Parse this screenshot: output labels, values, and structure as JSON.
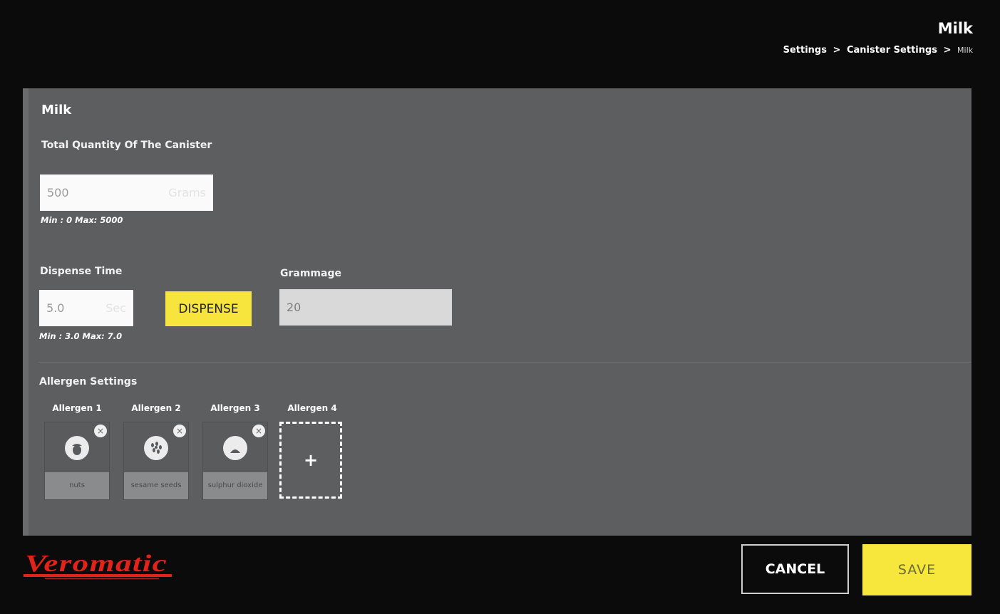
{
  "header": {
    "title": "Milk",
    "breadcrumb": [
      "Settings",
      "Canister Settings",
      "Milk"
    ],
    "breadcrumb_separator": ">"
  },
  "panel": {
    "section_title": "Milk",
    "total_quantity": {
      "label": "Total Quantity Of The Canister",
      "value": "500",
      "unit": "Grams",
      "hint": "Min : 0 Max: 5000"
    },
    "dispense_time": {
      "label": "Dispense Time",
      "value": "5.0",
      "unit": "Sec",
      "hint": "Min : 3.0 Max: 7.0"
    },
    "dispense_button": "DISPENSE",
    "grammage": {
      "label": "Grammage",
      "value": "20"
    },
    "allergen_settings": {
      "label": "Allergen Settings",
      "allergens": [
        {
          "label": "Allergen 1",
          "name": "nuts",
          "icon": "nut-icon"
        },
        {
          "label": "Allergen 2",
          "name": "sesame seeds",
          "icon": "sesame-icon"
        },
        {
          "label": "Allergen 3",
          "name": "sulphur dioxide",
          "icon": "sulphur-icon"
        }
      ],
      "empty_slot": {
        "label": "Allergen 4",
        "add_symbol": "+"
      },
      "remove_symbol": "×"
    }
  },
  "footer": {
    "logo_text": "Veromatic",
    "cancel_label": "CANCEL",
    "save_label": "SAVE"
  },
  "colors": {
    "accent_yellow": "#f7e43c",
    "panel_bg": "#5d5e60",
    "logo_red": "#e32219"
  }
}
